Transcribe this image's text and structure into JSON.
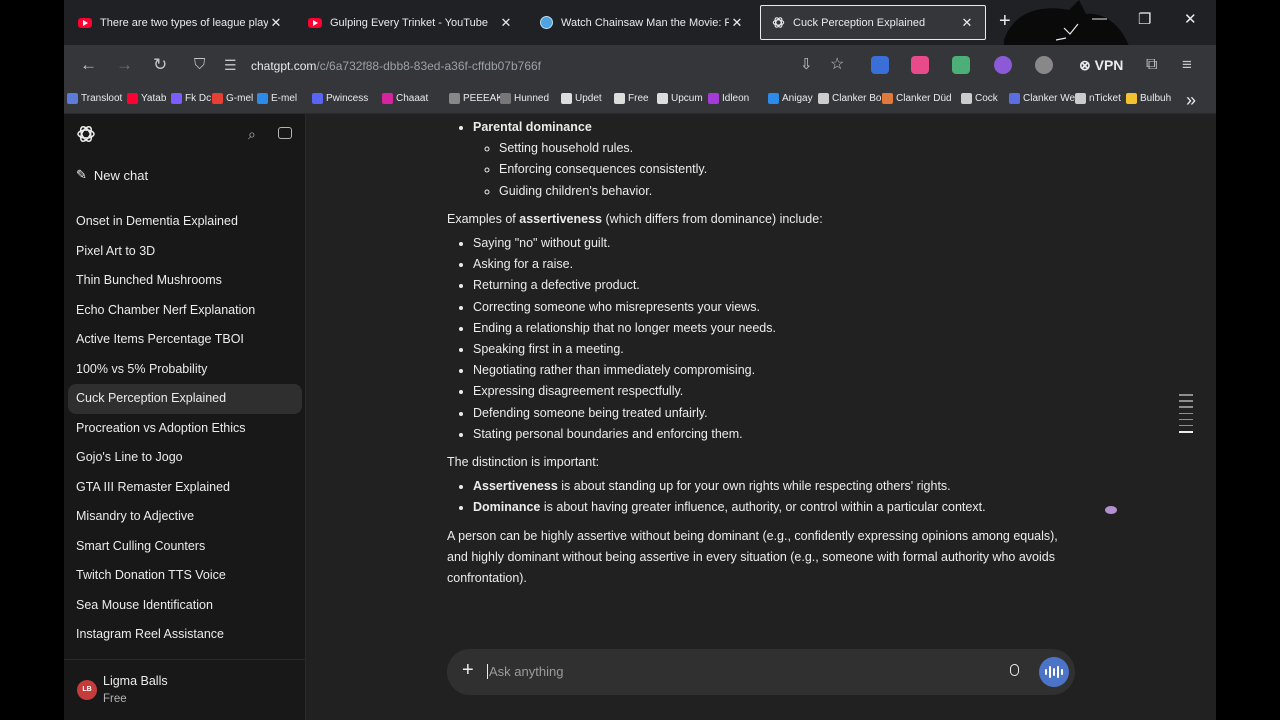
{
  "tabs": [
    {
      "title": "There are two types of league players",
      "favicon": "youtube-icon",
      "active": false
    },
    {
      "title": "Gulping Every Trinket - YouTube",
      "favicon": "youtube-icon",
      "active": false
    },
    {
      "title": "Watch Chainsaw Man the Movie: Reze",
      "favicon": "globe-icon",
      "active": false
    },
    {
      "title": "Cuck Perception Explained",
      "favicon": "chatgpt-icon",
      "active": true
    }
  ],
  "address_bar": {
    "host": "chatgpt.com",
    "path": "/c/6a732f88-dbb8-83ed-a36f-cffdb07b766f"
  },
  "toolbar": {
    "vpn_label": "VPN"
  },
  "bookmarks": [
    {
      "label": "Transloot",
      "color": "#5b7cd9"
    },
    {
      "label": "Yatab",
      "color": "#ff0033"
    },
    {
      "label": "Fk Dc",
      "color": "#7a5cff"
    },
    {
      "label": "G-mel",
      "color": "#e44134"
    },
    {
      "label": "E-mel",
      "color": "#2c8be8"
    },
    {
      "label": "Pwincess",
      "color": "#5865f2"
    },
    {
      "label": "Chaaat",
      "color": "#d6249f"
    },
    {
      "label": "PEEEAK",
      "color": "#888888"
    },
    {
      "label": "Hunned",
      "color": "#777777"
    },
    {
      "label": "Updet",
      "color": "#dddddd"
    },
    {
      "label": "Free",
      "color": "#dddddd"
    },
    {
      "label": "Upcum",
      "color": "#dddddd"
    },
    {
      "label": "Idleon",
      "color": "#a43bd8"
    },
    {
      "label": "Anigay",
      "color": "#2c8be8"
    },
    {
      "label": "Clanker Boi",
      "color": "#cccccc"
    },
    {
      "label": "Clanker Düd",
      "color": "#e07a3c"
    },
    {
      "label": "Cock",
      "color": "#cccccc"
    },
    {
      "label": "Clanker Wel",
      "color": "#5b6ee1"
    },
    {
      "label": "nTicket",
      "color": "#cccccc"
    },
    {
      "label": "Bulbuh",
      "color": "#f2c230"
    }
  ],
  "sidebar": {
    "new_chat": "New chat",
    "chats": [
      "Onset in Dementia Explained",
      "Pixel Art to 3D",
      "Thin Bunched Mushrooms",
      "Echo Chamber Nerf Explanation",
      "Active Items Percentage TBOI",
      "100% vs 5% Probability",
      "Cuck Perception Explained",
      "Procreation vs Adoption Ethics",
      "Gojo's Line to Jogo",
      "GTA III Remaster Explained",
      "Misandry to Adjective",
      "Smart Culling Counters",
      "Twitch Donation TTS Voice",
      "Sea Mouse Identification",
      "Instagram Reel Assistance"
    ],
    "active_chat_index": 6,
    "user": {
      "initials": "LB",
      "name": "Ligma Balls",
      "plan": "Free"
    }
  },
  "message": {
    "parental_heading": "Parental dominance",
    "parental_items": [
      "Setting household rules.",
      "Enforcing consequences consistently.",
      "Guiding children's behavior."
    ],
    "assert_intro_pre": "Examples of ",
    "assert_intro_bold": "assertiveness",
    "assert_intro_post": " (which differs from dominance) include:",
    "assert_items": [
      "Saying \"no\" without guilt.",
      "Asking for a raise.",
      "Returning a defective product.",
      "Correcting someone who misrepresents your views.",
      "Ending a relationship that no longer meets your needs.",
      "Speaking first in a meeting.",
      "Negotiating rather than immediately compromising.",
      "Expressing disagreement respectfully.",
      "Defending someone being treated unfairly.",
      "Stating personal boundaries and enforcing them."
    ],
    "distinction_intro": "The distinction is important:",
    "distinction_items": [
      {
        "bold": "Assertiveness",
        "text": " is about standing up for your own rights while respecting others' rights."
      },
      {
        "bold": "Dominance",
        "text": " is about having greater influence, authority, or control within a particular context."
      }
    ],
    "conclusion": "A person can be highly assertive without being dominant (e.g., confidently expressing opinions among equals), and highly dominant without being assertive in every situation (e.g., someone with formal authority who avoids confrontation)."
  },
  "composer": {
    "placeholder": "Ask anything"
  },
  "colors": {
    "accent_voice": "#4b74c9",
    "active_tab_border": "#e8eaed",
    "sidebar_bg": "#181818",
    "main_bg": "#212121"
  }
}
